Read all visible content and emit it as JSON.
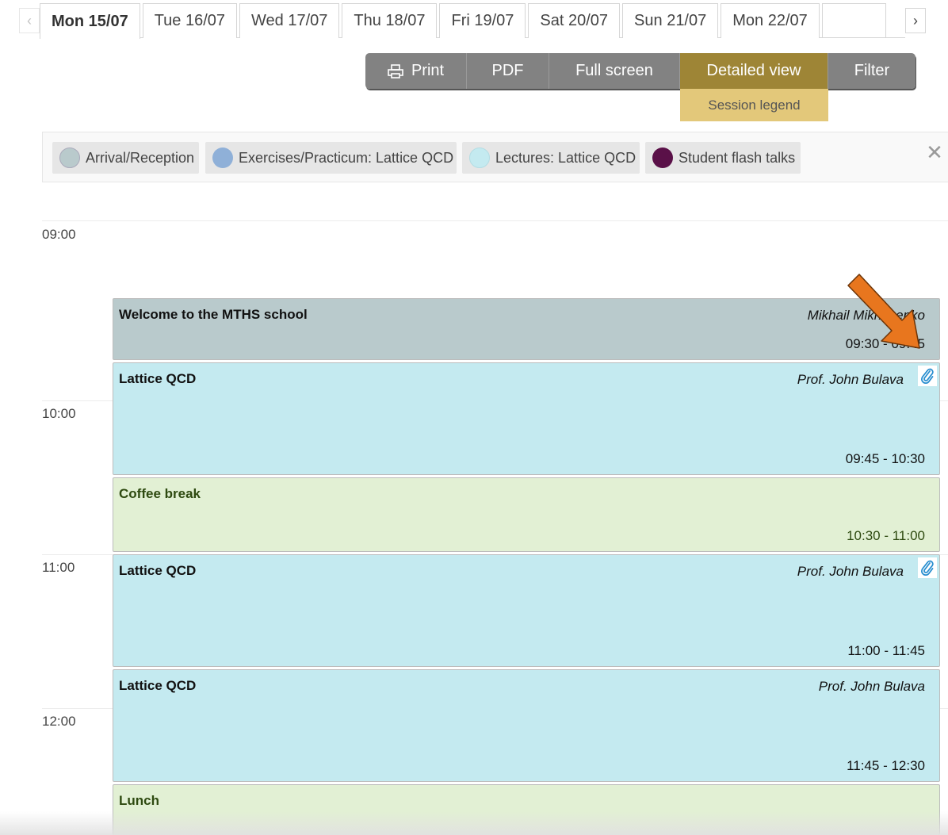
{
  "days": {
    "prev_icon": "chevron-left-icon",
    "next_icon": "chevron-right-icon",
    "tabs": [
      {
        "label": "Mon 15/07",
        "active": true
      },
      {
        "label": "Tue 16/07"
      },
      {
        "label": "Wed 17/07"
      },
      {
        "label": "Thu 18/07"
      },
      {
        "label": "Fri 19/07"
      },
      {
        "label": "Sat 20/07"
      },
      {
        "label": "Sun 21/07"
      },
      {
        "label": "Mon 22/07"
      }
    ]
  },
  "toolbar": {
    "print": "Print",
    "print_icon": "printer-icon",
    "pdf": "PDF",
    "fullscreen": "Full screen",
    "detailed": "Detailed view",
    "filter": "Filter",
    "session_legend": "Session legend"
  },
  "legend": {
    "items": [
      {
        "label": "Arrival/Reception",
        "color": "#b9cacc"
      },
      {
        "label": "Exercises/Practicum: Lattice QCD",
        "color": "#8fb0d8"
      },
      {
        "label": "Lectures: Lattice QCD",
        "color": "#c4eaf0"
      },
      {
        "label": "Student flash talks",
        "color": "#5a1048"
      }
    ],
    "close_icon": "close-icon"
  },
  "timetable": {
    "hours": [
      "09:00",
      "10:00",
      "11:00",
      "12:00"
    ],
    "entries": [
      {
        "title": "Welcome to the MTHS school",
        "speaker": "Mikhail Mikhasenko",
        "time": "09:30 - 09:45",
        "bg": "#b9cacc",
        "text_color": "#111111",
        "attachment": false
      },
      {
        "title": "Lattice QCD",
        "speaker": "Prof. John Bulava",
        "time": "09:45 - 10:30",
        "bg": "#c4eaf0",
        "text_color": "#111111",
        "attachment": true
      },
      {
        "title": "Coffee break",
        "speaker": "",
        "time": "10:30 - 11:00",
        "bg": "#e2f0d4",
        "text_color": "#2e4a10",
        "attachment": false
      },
      {
        "title": "Lattice QCD",
        "speaker": "Prof. John Bulava",
        "time": "11:00 - 11:45",
        "bg": "#c4eaf0",
        "text_color": "#111111",
        "attachment": true
      },
      {
        "title": "Lattice QCD",
        "speaker": "Prof. John Bulava",
        "time": "11:45 - 12:30",
        "bg": "#c4eaf0",
        "text_color": "#111111",
        "attachment": false
      },
      {
        "title": "Lunch",
        "speaker": "",
        "time": "",
        "bg": "#e2f0d4",
        "text_color": "#2e4a10",
        "attachment": false
      }
    ],
    "attachment_icon": "paperclip-icon"
  },
  "annotation": {
    "arrow_color": "#e8761e",
    "arrow_icon": "pointer-arrow-icon"
  }
}
